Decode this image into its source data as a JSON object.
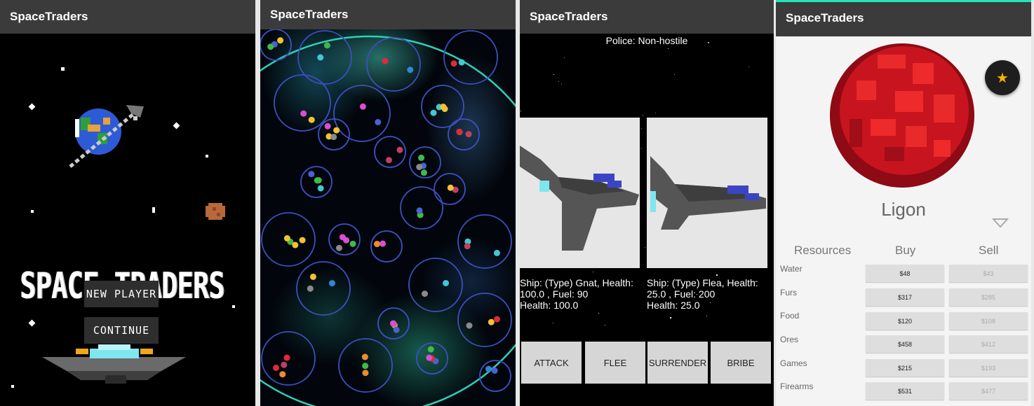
{
  "app_title": "SpaceTraders",
  "screen1": {
    "logo_text": "SPACE TRADERS",
    "new_player_label": "NEW PLAYER",
    "continue_label": "CONTINUE"
  },
  "screen3": {
    "police_status": "Police: Non-hostile",
    "player_ship_line1": "Ship: (Type) Gnat, Health:",
    "player_ship_line2": "100.0 , Fuel: 90",
    "player_ship_line3": "Health: 100.0",
    "enemy_ship_line1": "Ship: (Type) Flea, Health:",
    "enemy_ship_line2": "25.0 , Fuel: 200",
    "enemy_ship_line3": "Health: 25.0",
    "actions": [
      "ATTACK",
      "FLEE",
      "SURRENDER",
      "BRIBE"
    ]
  },
  "screen4": {
    "planet_name": "Ligon",
    "favorite_icon": "star-icon",
    "headers": {
      "resources": "Resources",
      "buy": "Buy",
      "sell": "Sell"
    },
    "resources": [
      {
        "name": "Water",
        "buy": "$48",
        "sell": "$43"
      },
      {
        "name": "Furs",
        "buy": "$317",
        "sell": "$285"
      },
      {
        "name": "Food",
        "buy": "$120",
        "sell": "$108"
      },
      {
        "name": "Ores",
        "buy": "$458",
        "sell": "$412"
      },
      {
        "name": "Games",
        "buy": "$215",
        "sell": "$193"
      },
      {
        "name": "Firearms",
        "buy": "$531",
        "sell": "$477"
      }
    ],
    "colors": {
      "accent": "#1de9b6",
      "planet": "#c8141e"
    }
  }
}
